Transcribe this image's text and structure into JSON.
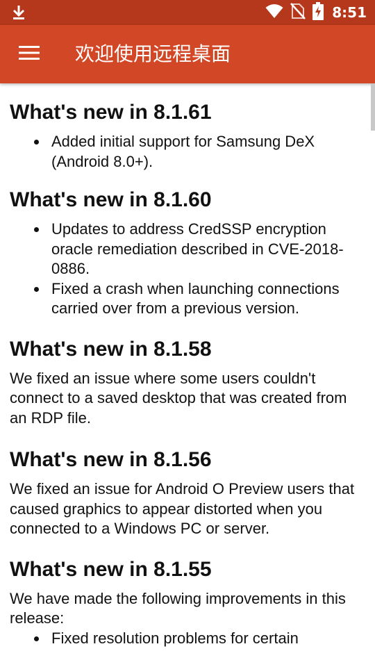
{
  "status_bar": {
    "time": "8:51",
    "icons": [
      "download-icon",
      "wifi-icon",
      "no-sim-icon",
      "battery-charging-icon"
    ],
    "background": "#b6381c"
  },
  "app_bar": {
    "title": "欢迎使用远程桌面",
    "menu_icon": "menu-icon",
    "background": "#d24726"
  },
  "content": {
    "sections": [
      {
        "heading": "What's new in 8.1.61",
        "bullets": [
          "Added initial support for Samsung DeX (Android 8.0+)."
        ]
      },
      {
        "heading": "What's new in 8.1.60",
        "bullets": [
          "Updates to address CredSSP encryption oracle remediation described in CVE-2018-0886.",
          "Fixed a crash when launching connections carried over from a previous version."
        ]
      },
      {
        "heading": "What's new in 8.1.58",
        "paragraph": "We fixed an issue where some users couldn't connect to a saved desktop that was created from an RDP file."
      },
      {
        "heading": "What's new in 8.1.56",
        "paragraph": "We fixed an issue for Android O Preview users that caused graphics to appear distorted when you connected to a Windows PC or server."
      },
      {
        "heading": "What's new in 8.1.55",
        "paragraph": "We have made the following improvements in this release:",
        "bullets": [
          "Fixed resolution problems for certain"
        ]
      }
    ]
  }
}
